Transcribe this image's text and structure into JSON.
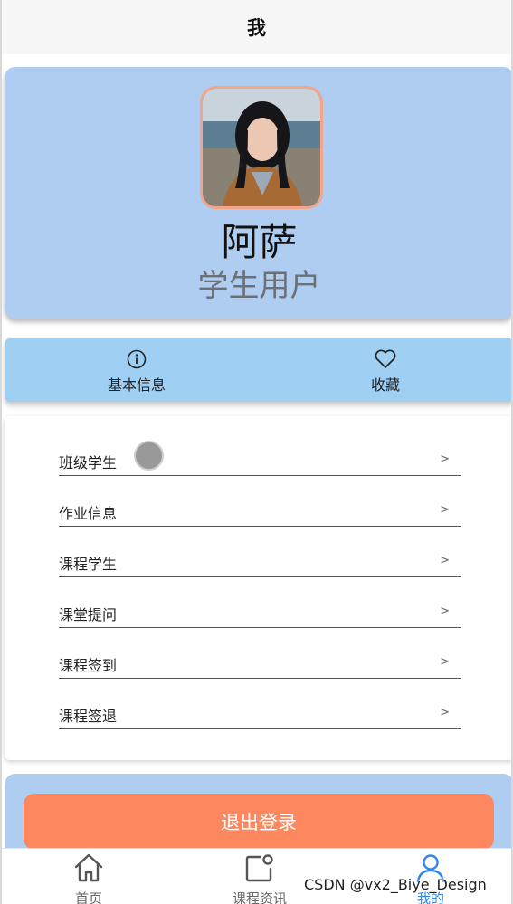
{
  "header": {
    "title": "我"
  },
  "profile": {
    "name": "阿萨",
    "role": "学生用户"
  },
  "quick_actions": [
    {
      "label": "基本信息",
      "icon": "info-icon"
    },
    {
      "label": "收藏",
      "icon": "heart-icon"
    }
  ],
  "menu": {
    "arrow": ">",
    "items": [
      {
        "label": "班级学生"
      },
      {
        "label": "作业信息"
      },
      {
        "label": "课程学生"
      },
      {
        "label": "课堂提问"
      },
      {
        "label": "课程签到"
      },
      {
        "label": "课程签退"
      }
    ]
  },
  "logout": {
    "label": "退出登录"
  },
  "tabs": [
    {
      "label": "首页",
      "icon": "home-icon",
      "active": false
    },
    {
      "label": "课程资讯",
      "icon": "news-icon",
      "active": false
    },
    {
      "label": "我的",
      "icon": "user-icon",
      "active": true
    }
  ],
  "watermark": "CSDN @vx2_Biye_Design",
  "colors": {
    "profile_bg": "#aecdf0",
    "quick_bar_bg": "#9fcff3",
    "logout_button": "#fd8860",
    "active_tab": "#2f86e8"
  }
}
